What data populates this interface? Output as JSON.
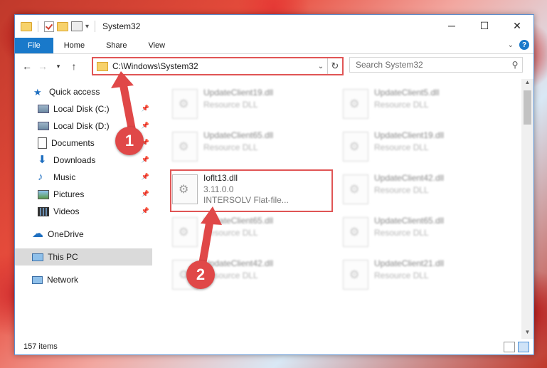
{
  "window": {
    "title": "System32",
    "controls": {
      "minimize": "─",
      "maximize": "☐",
      "close": "✕"
    }
  },
  "ribbon": {
    "tabs": [
      "File",
      "Home",
      "Share",
      "View"
    ],
    "help": "?"
  },
  "address": {
    "path": "C:\\Windows\\System32"
  },
  "search": {
    "placeholder": "Search System32"
  },
  "sidebar": {
    "items": [
      {
        "label": "Quick access",
        "icon": "star-icon"
      },
      {
        "label": "Local Disk (C:)",
        "icon": "drive-icon",
        "pinned": true
      },
      {
        "label": "Local Disk (D:)",
        "icon": "drive-icon",
        "pinned": true
      },
      {
        "label": "Documents",
        "icon": "documents-icon",
        "pinned": true
      },
      {
        "label": "Downloads",
        "icon": "downloads-icon",
        "pinned": true
      },
      {
        "label": "Music",
        "icon": "music-icon",
        "pinned": true
      },
      {
        "label": "Pictures",
        "icon": "pictures-icon",
        "pinned": true
      },
      {
        "label": "Videos",
        "icon": "videos-icon",
        "pinned": true
      },
      {
        "label": "OneDrive",
        "icon": "onedrive-icon"
      },
      {
        "label": "This PC",
        "icon": "this-pc-icon",
        "selected": true
      },
      {
        "label": "Network",
        "icon": "network-icon"
      }
    ]
  },
  "files": {
    "left": [
      {
        "name": "UpdateClient19.dll",
        "sub": "Resource DLL"
      },
      {
        "name": "UpdateClient65.dll",
        "sub": "Resource DLL"
      },
      {
        "name": "Ioflt13.dll",
        "version": "3.11.0.0",
        "sub": "INTERSOLV Flat-file..."
      },
      {
        "name": "UpdateClient65.dll",
        "sub": "Resource DLL"
      },
      {
        "name": "UpdateClient42.dll",
        "sub": "Resource DLL"
      }
    ],
    "right": [
      {
        "name": "UpdateClient5.dll",
        "sub": "Resource DLL"
      },
      {
        "name": "UpdateClient19.dll",
        "sub": "Resource DLL"
      },
      {
        "name": "UpdateClient42.dll",
        "sub": "Resource DLL"
      },
      {
        "name": "UpdateClient65.dll",
        "sub": "Resource DLL"
      },
      {
        "name": "UpdateClient21.dll",
        "sub": "Resource DLL"
      }
    ]
  },
  "status": {
    "count": "157 items"
  },
  "annotations": {
    "step1": "1",
    "step2": "2"
  },
  "colors": {
    "accent": "#1979ca",
    "highlight": "#e05555"
  }
}
